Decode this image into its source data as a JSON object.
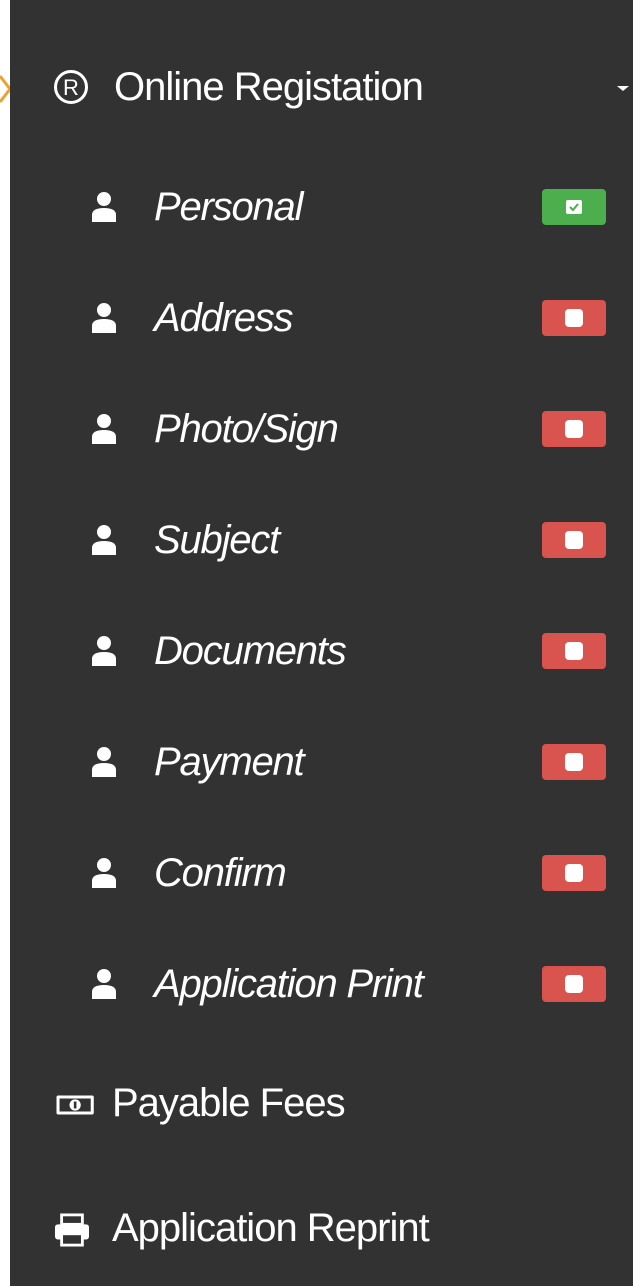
{
  "menu": {
    "parent": {
      "label": "Online Registation",
      "icon": "registered-icon",
      "expanded": true
    },
    "items": [
      {
        "label": "Personal",
        "icon": "user-icon",
        "status": "complete",
        "status_color": "#4cae4c"
      },
      {
        "label": "Address",
        "icon": "user-icon",
        "status": "incomplete",
        "status_color": "#d9534f"
      },
      {
        "label": "Photo/Sign",
        "icon": "user-icon",
        "status": "incomplete",
        "status_color": "#d9534f"
      },
      {
        "label": "Subject",
        "icon": "user-icon",
        "status": "incomplete",
        "status_color": "#d9534f"
      },
      {
        "label": "Documents",
        "icon": "user-icon",
        "status": "incomplete",
        "status_color": "#d9534f"
      },
      {
        "label": "Payment",
        "icon": "user-icon",
        "status": "incomplete",
        "status_color": "#d9534f"
      },
      {
        "label": "Confirm",
        "icon": "user-icon",
        "status": "incomplete",
        "status_color": "#d9534f"
      },
      {
        "label": "Application Print",
        "icon": "user-icon",
        "status": "incomplete",
        "status_color": "#d9534f"
      }
    ],
    "payable_fees": {
      "label": "Payable Fees",
      "icon": "money-icon"
    },
    "application_reprint": {
      "label": "Application Reprint",
      "icon": "print-icon"
    }
  },
  "colors": {
    "sidebar_bg": "#323232",
    "active_marker": "#f0a030",
    "complete": "#4cae4c",
    "incomplete": "#d9534f"
  }
}
